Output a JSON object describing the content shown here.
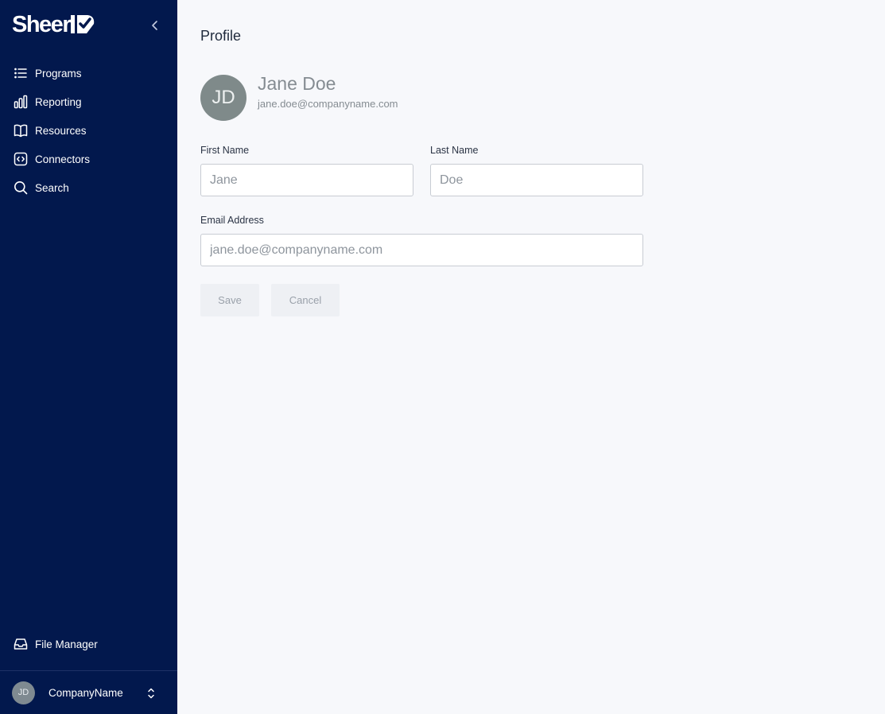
{
  "brand": {
    "logo_text": "Sheer"
  },
  "sidebar": {
    "items": [
      {
        "label": "Programs",
        "icon": "list-icon"
      },
      {
        "label": "Reporting",
        "icon": "bar-chart-icon"
      },
      {
        "label": "Resources",
        "icon": "book-icon"
      },
      {
        "label": "Connectors",
        "icon": "code-icon"
      },
      {
        "label": "Search",
        "icon": "search-icon"
      }
    ],
    "file_manager": {
      "label": "File Manager",
      "icon": "inbox-icon"
    },
    "account": {
      "initials": "JD",
      "name": "CompanyName"
    }
  },
  "main": {
    "title": "Profile",
    "profile": {
      "initials": "JD",
      "name": "Jane Doe",
      "email": "jane.doe@companyname.com"
    },
    "form": {
      "first_name_label": "First Name",
      "first_name_placeholder": "Jane",
      "last_name_label": "Last Name",
      "last_name_placeholder": "Doe",
      "email_label": "Email Address",
      "email_placeholder": "jane.doe@companyname.com",
      "save_label": "Save",
      "cancel_label": "Cancel"
    }
  },
  "colors": {
    "sidebar_bg": "#02184d",
    "main_bg": "#f7f8fb",
    "avatar_bg": "#7f8a8a",
    "button_bg": "#eef0f4"
  }
}
